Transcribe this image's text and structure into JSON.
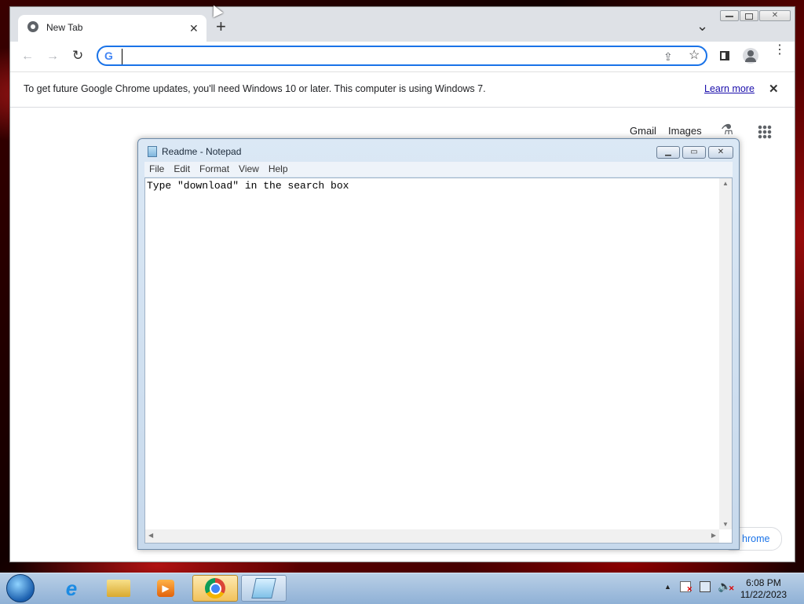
{
  "chrome": {
    "tab_title": "New Tab",
    "new_tab_symbol": "+",
    "dropdown_symbol": "⌄",
    "omnibox_value": "",
    "infobar_message": "To get future Google Chrome updates, you'll need Windows 10 or later. This computer is using Windows 7.",
    "learn_more": "Learn more",
    "infobar_close": "✕",
    "ntp_links": {
      "gmail": "Gmail",
      "images": "Images"
    },
    "customize_fragment": "hrome",
    "accent_color": "#1a73e8"
  },
  "notepad": {
    "title": "Readme - Notepad",
    "menu": [
      "File",
      "Edit",
      "Format",
      "View",
      "Help"
    ],
    "content": "Type \"download\" in the search box"
  },
  "taskbar": {
    "time": "6:08 PM",
    "date": "11/22/2023",
    "items": [
      "start-orb-icon",
      "internet-explorer-icon",
      "file-explorer-icon",
      "media-player-icon",
      "chrome-icon",
      "notepad-icon"
    ]
  }
}
